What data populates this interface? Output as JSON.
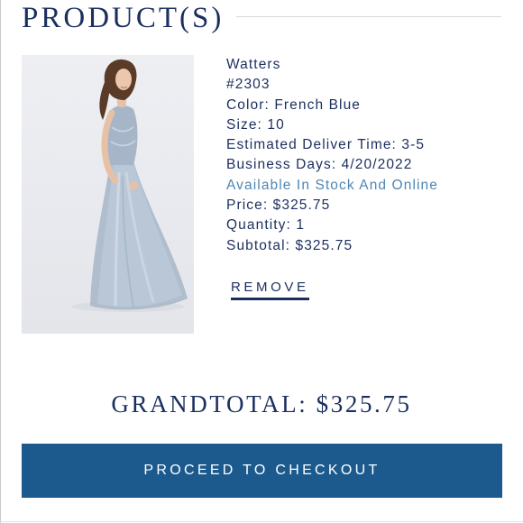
{
  "section": {
    "title": "PRODUCT(S)"
  },
  "product": {
    "image_alt": "Model wearing French Blue tulle gown",
    "brand": "Watters",
    "sku": "#2303",
    "color_line": "Color: French Blue",
    "size_line": "Size: 10",
    "delivery_line_1": "Estimated Deliver Time: 3-5",
    "delivery_line_2": "Business Days: 4/20/2022",
    "availability": "Available In Stock And Online",
    "price_line": "Price: $325.75",
    "quantity_line": "Quantity: 1",
    "subtotal_line": "Subtotal: $325.75",
    "remove_label": "REMOVE"
  },
  "summary": {
    "grand_total": "GRANDTOTAL: $325.75"
  },
  "checkout": {
    "label": "PROCEED TO CHECKOUT"
  },
  "colors": {
    "navy_text": "#1b2f5e",
    "availability_blue": "#4f86b5",
    "checkout_button": "#1c5a8e",
    "image_background": "#eeeff3"
  }
}
